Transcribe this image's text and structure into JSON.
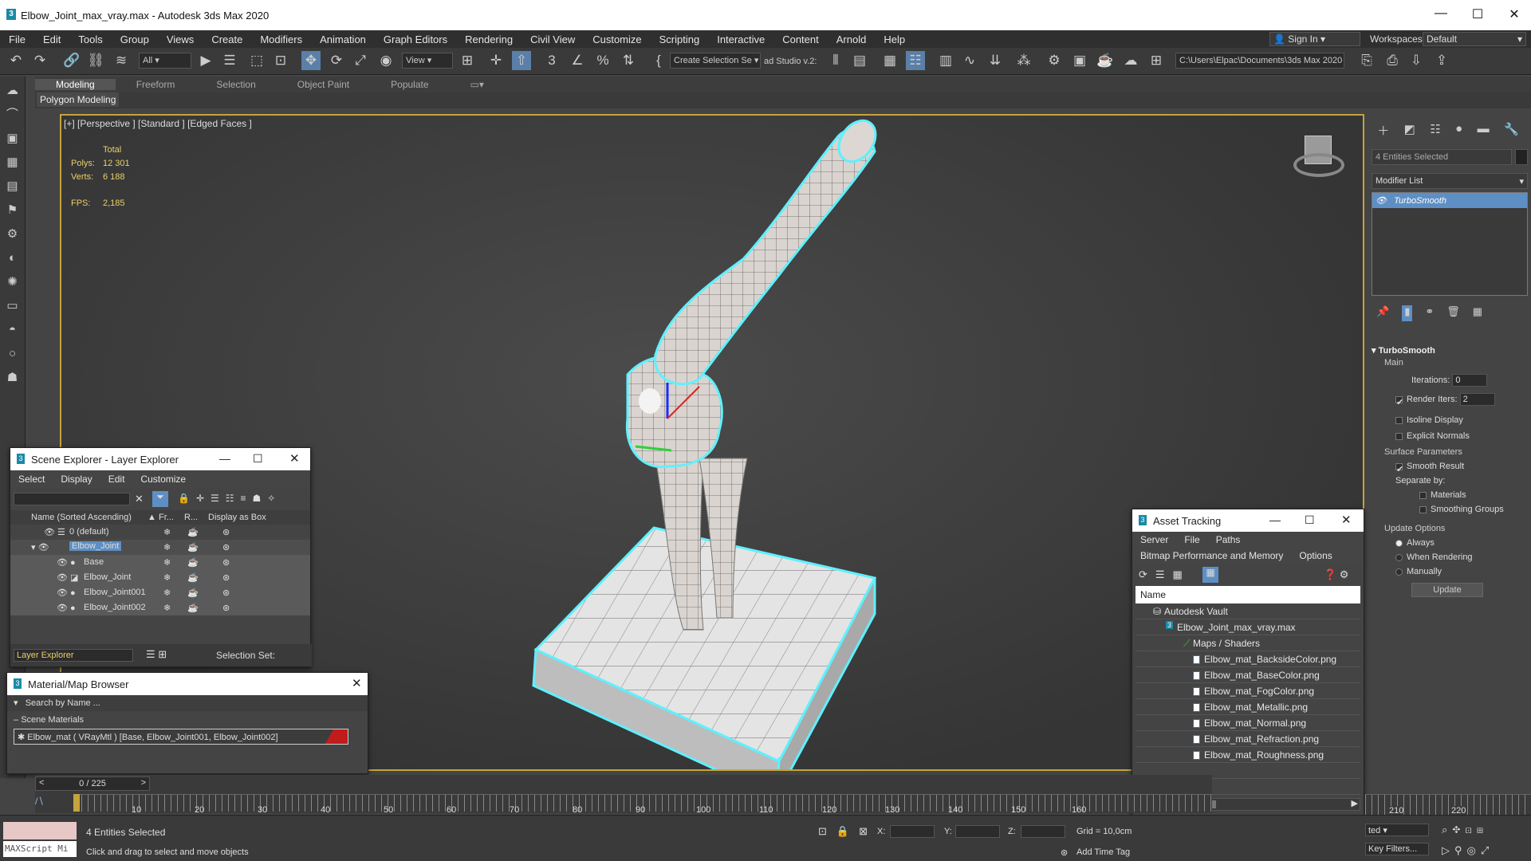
{
  "window": {
    "title": "Elbow_Joint_max_vray.max - Autodesk 3ds Max 2020"
  },
  "menu": [
    "File",
    "Edit",
    "Tools",
    "Group",
    "Views",
    "Create",
    "Modifiers",
    "Animation",
    "Graph Editors",
    "Rendering",
    "Civil View",
    "Customize",
    "Scripting",
    "Interactive",
    "Content",
    "Arnold",
    "Help"
  ],
  "account": {
    "sign_in": "Sign In",
    "workspaces_label": "Workspaces:",
    "workspace": "Default"
  },
  "toolbar": {
    "filter": "All",
    "view": "View",
    "selection_set": "Create Selection Se",
    "studio": "ad Studio v.2:",
    "path": "C:\\Users\\Elpac\\Documents\\3ds Max 2020"
  },
  "ribbon": {
    "tabs": [
      "Modeling",
      "Freeform",
      "Selection",
      "Object Paint",
      "Populate"
    ],
    "sub": "Polygon Modeling"
  },
  "viewport": {
    "label": "[+] [Perspective ] [Standard ] [Edged Faces ]",
    "total_label": "Total",
    "polys_label": "Polys:",
    "polys": "12 301",
    "verts_label": "Verts:",
    "verts": "6 188",
    "fps_label": "FPS:",
    "fps": "2,185"
  },
  "command_panel": {
    "selected": "4 Entities Selected",
    "modifier_list": "Modifier List",
    "modifier": "TurboSmooth",
    "rollout_title": "TurboSmooth",
    "main": "Main",
    "iterations_label": "Iterations:",
    "iterations": "0",
    "render_iters_label": "Render Iters:",
    "render_iters": "2",
    "isoline": "Isoline Display",
    "explicit": "Explicit Normals",
    "surface_params": "Surface Parameters",
    "smooth_result": "Smooth Result",
    "separate_by": "Separate by:",
    "materials": "Materials",
    "smoothing_groups": "Smoothing Groups",
    "update_options": "Update Options",
    "always": "Always",
    "when_rendering": "When Rendering",
    "manually": "Manually",
    "update_btn": "Update"
  },
  "scene_explorer": {
    "title": "Scene Explorer - Layer Explorer",
    "menu": [
      "Select",
      "Display",
      "Edit",
      "Customize"
    ],
    "col_name": "Name (Sorted Ascending)",
    "col_fr": "Fr...",
    "col_r": "R...",
    "col_box": "Display as Box",
    "rows": [
      "0 (default)",
      "Elbow_Joint",
      "Base",
      "Elbow_Joint",
      "Elbow_Joint001",
      "Elbow_Joint002"
    ],
    "footer_layer": "Layer Explorer",
    "footer_selset": "Selection Set:"
  },
  "material_browser": {
    "title": "Material/Map Browser",
    "search": "Search by Name ...",
    "group": "Scene Materials",
    "item": "Elbow_mat  ( VRayMtl )  [Base, Elbow_Joint001, Elbow_Joint002]"
  },
  "asset_tracking": {
    "title": "Asset Tracking",
    "menu1": [
      "Server",
      "File",
      "Paths"
    ],
    "menu2": [
      "Bitmap Performance and Memory",
      "Options"
    ],
    "col_name": "Name",
    "vault": "Autodesk Vault",
    "file": "Elbow_Joint_max_vray.max",
    "maps": "Maps / Shaders",
    "bitmaps": [
      "Elbow_mat_BacksideColor.png",
      "Elbow_mat_BaseColor.png",
      "Elbow_mat_FogColor.png",
      "Elbow_mat_Metallic.png",
      "Elbow_mat_Normal.png",
      "Elbow_mat_Refraction.png",
      "Elbow_mat_Roughness.png"
    ]
  },
  "timeline": {
    "frame": "0 / 225",
    "ticks": [
      "10",
      "20",
      "30",
      "40",
      "50",
      "60",
      "70",
      "80",
      "90",
      "100",
      "110",
      "120",
      "130",
      "140",
      "150",
      "160",
      "210",
      "220"
    ]
  },
  "status": {
    "maxscript": "MAXScript Mi",
    "selected": "4 Entities Selected",
    "prompt": "Click and drag to select and move objects",
    "x": "X:",
    "y": "Y:",
    "z": "Z:",
    "grid": "Grid = 10,0cm",
    "add_time_tag": "Add Time Tag",
    "key_filters": "Key Filters...",
    "selected_dd": "ted"
  }
}
